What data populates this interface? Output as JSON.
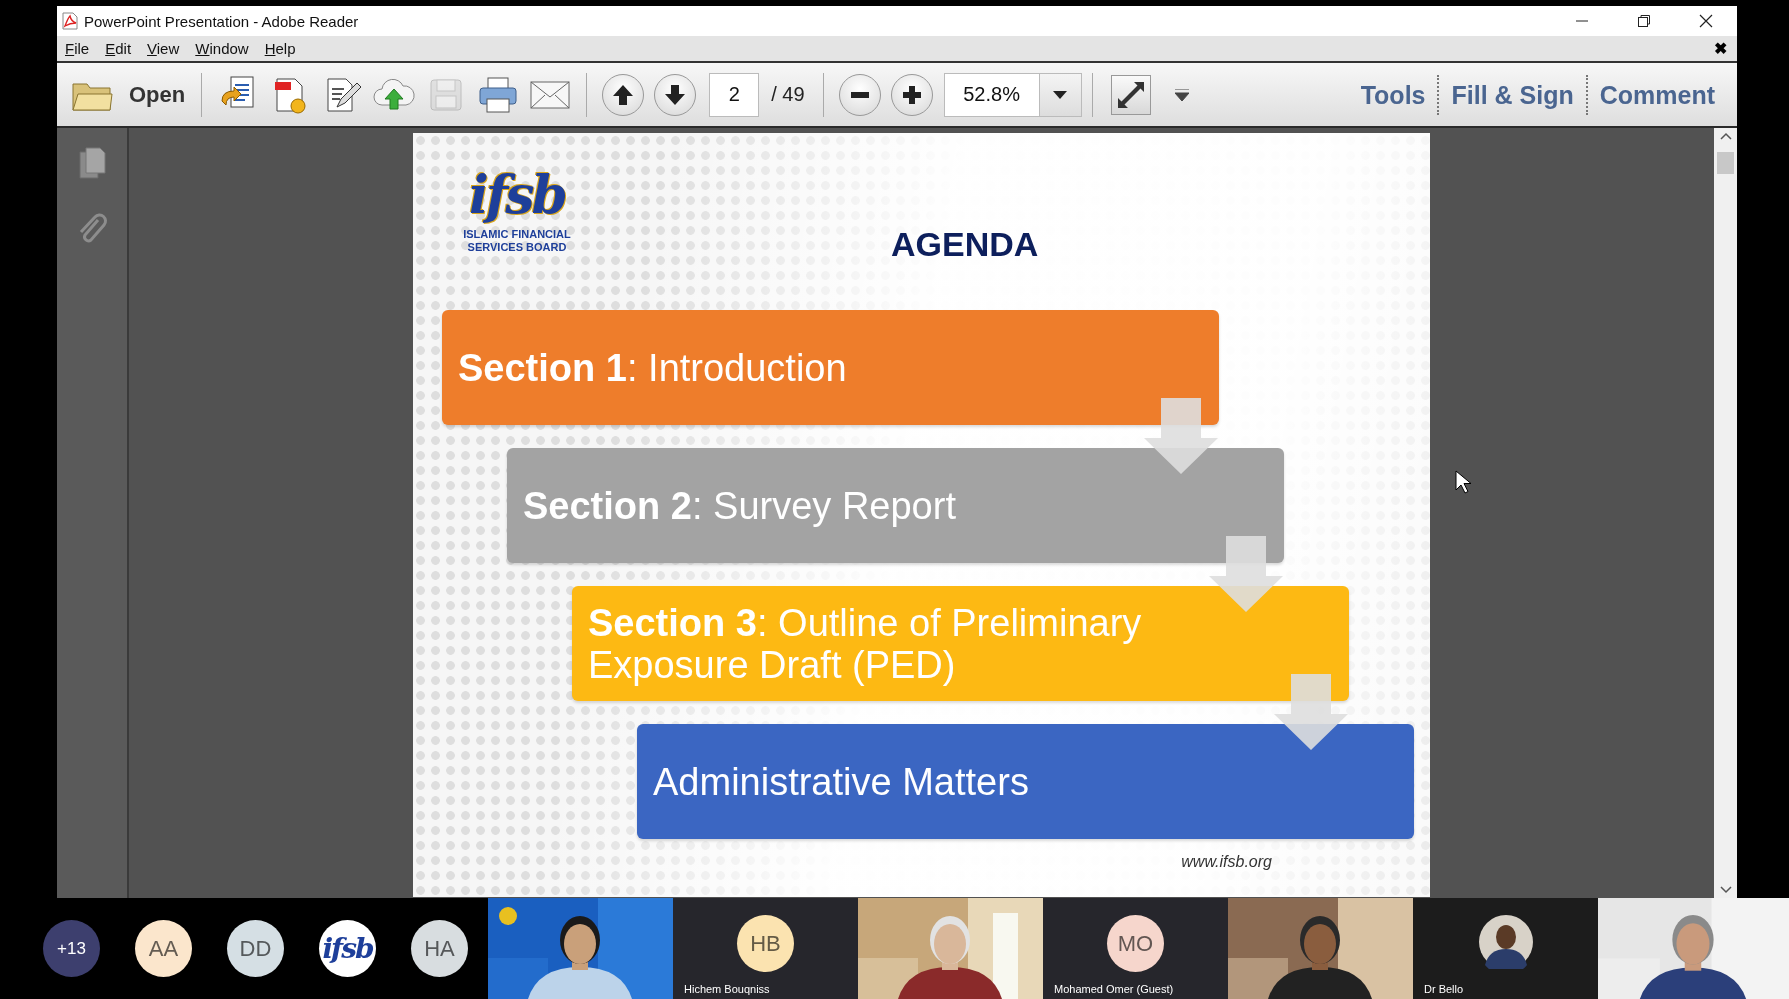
{
  "window": {
    "title": "PowerPoint Presentation - Adobe Reader",
    "close_document": "✖"
  },
  "menu": [
    "File",
    "Edit",
    "View",
    "Window",
    "Help"
  ],
  "toolbar": {
    "open_label": "Open",
    "tools": [
      {
        "kind": "create",
        "disabled": false
      },
      {
        "kind": "export",
        "disabled": false
      },
      {
        "kind": "edit",
        "disabled": false
      },
      {
        "kind": "upload",
        "disabled": false
      },
      {
        "kind": "save",
        "disabled": true
      },
      {
        "kind": "print",
        "disabled": false
      },
      {
        "kind": "email",
        "disabled": false
      }
    ],
    "page": "2",
    "page_total": "/ 49",
    "zoom": "52.8%",
    "panels": [
      "Tools",
      "Fill & Sign",
      "Comment"
    ]
  },
  "slide": {
    "logo": "ifsb",
    "organization": "ISLAMIC FINANCIAL SERVICES BOARD",
    "title": "AGENDA",
    "sections": [
      {
        "text": "**Section 1**: Introduction",
        "color": "#ee7d2b"
      },
      {
        "text": "**Section 2**: Survey Report",
        "color": "#a3a3a3"
      },
      {
        "text": "**Section 3**: Outline of Preliminary Exposure Draft (PED)",
        "color": "#fdb913"
      },
      {
        "text": "Administrative Matters",
        "color": "#3b66c2"
      }
    ],
    "footer": "www.ifsb.org"
  },
  "participants": [
    {
      "kind": "count",
      "label": "+13",
      "color": "#3d3f6e"
    },
    {
      "kind": "initials",
      "label": "AA",
      "color": "#fbe6cc"
    },
    {
      "kind": "initials",
      "label": "DD",
      "color": "#d5dfe4"
    },
    {
      "kind": "logo",
      "label": "ifsb",
      "color": "#ffffff"
    },
    {
      "kind": "initials",
      "label": "HA",
      "color": "#d8dde0"
    },
    {
      "kind": "video"
    },
    {
      "kind": "tile",
      "initials": "HB",
      "name": "Hichem Bouqniss",
      "color": "#fbe3b0"
    },
    {
      "kind": "video"
    },
    {
      "kind": "tile",
      "initials": "MO",
      "name": "Mohamed Omer (Guest)",
      "color": "#f6d6cc"
    },
    {
      "kind": "video"
    },
    {
      "kind": "photo_tile",
      "name": "Dr Bello"
    },
    {
      "kind": "video"
    }
  ]
}
